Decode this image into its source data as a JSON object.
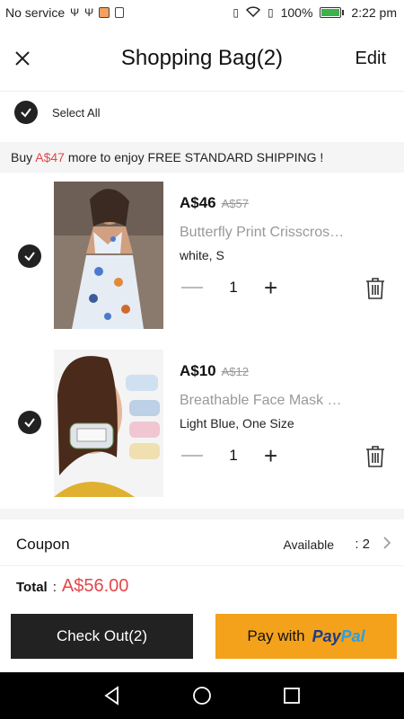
{
  "status_bar": {
    "carrier": "No service",
    "battery": "100%",
    "time": "2:22 pm"
  },
  "header": {
    "title": "Shopping Bag(2)",
    "edit_label": "Edit"
  },
  "select_all_label": "Select All",
  "shipping_banner": {
    "prefix": "Buy ",
    "amount": "A$47",
    "suffix": " more to enjoy FREE STANDARD SHIPPING",
    "trail": " !"
  },
  "items": [
    {
      "price": "A$46",
      "old_price": "A$57",
      "name": "Butterfly Print Crisscross Backless Set",
      "variant": "white, S",
      "quantity": "1"
    },
    {
      "price": "A$10",
      "old_price": "A$12",
      "name": "Breathable Face Mask With Clear Window",
      "variant": "Light Blue, One Size",
      "quantity": "1"
    }
  ],
  "coupon": {
    "label": "Coupon",
    "available_label": "Available",
    "count": ": 2"
  },
  "total": {
    "label": "Total",
    "colon": ":",
    "value": "A$56.00"
  },
  "buttons": {
    "checkout_label": "Check Out(2)",
    "paypal_prefix": "Pay with",
    "paypal_pay": "Pay",
    "paypal_pal": "Pal"
  },
  "colors": {
    "accent_red": "#e2474a",
    "paypal_button": "#f4a21b",
    "checkout_button": "#222222"
  }
}
